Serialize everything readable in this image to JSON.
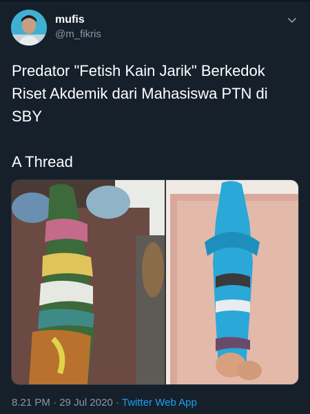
{
  "tweet": {
    "author": {
      "name": "mufis",
      "handle": "@m_fikris",
      "avatar_icon": "profile-avatar"
    },
    "text_line": "Predator \"Fetish Kain Jarik\" Berkedok Riset Akdemik dari Mahasiswa PTN di SBY",
    "thread_label": "A Thread",
    "media": {
      "left_photo": "bundled-cloth-wrapped-figure-on-mattress",
      "right_photo": "blue-cloth-wrapped-figure-with-feet"
    },
    "time": "8.21 PM",
    "separator": "·",
    "date": "29 Jul 2020",
    "separator2": "·",
    "source": "Twitter Web App"
  },
  "colors": {
    "background": "#15202b",
    "text": "#ffffff",
    "secondary": "#8899a6",
    "link": "#1da1f2"
  },
  "icons": {
    "menu": "chevron-down-icon"
  }
}
